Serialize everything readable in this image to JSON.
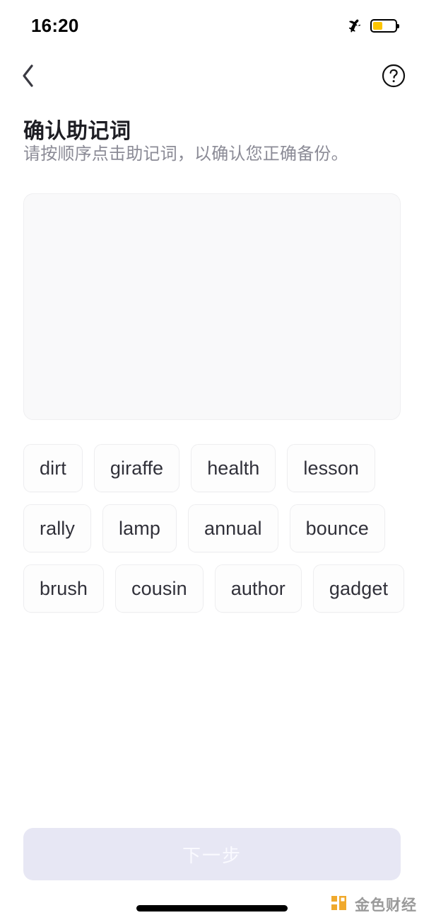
{
  "status_bar": {
    "time": "16:20",
    "airplane_icon": "airplane-mode-icon",
    "battery_icon": "battery-low-power-icon",
    "battery_color": "#fdc500",
    "battery_level_percent": 42
  },
  "nav_bar": {
    "back_icon": "chevron-left-icon",
    "help_icon": "question-mark-circle-icon"
  },
  "header": {
    "title": "确认助记词",
    "subtitle": "请按顺序点击助记词，以确认您正确备份。"
  },
  "answer_box": {
    "selected_words": [],
    "background_color": "#f9f9fa",
    "border_color": "#efeff1"
  },
  "word_pool": {
    "words": [
      "dirt",
      "giraffe",
      "health",
      "lesson",
      "rally",
      "lamp",
      "annual",
      "bounce",
      "brush",
      "cousin",
      "author",
      "gadget"
    ]
  },
  "footer": {
    "next_label": "下一步",
    "next_disabled": true,
    "next_background_color": "#e7e7f4",
    "next_text_color": "#fafaff"
  },
  "watermark": {
    "text": "金色财经",
    "logo_icon": "jinse-finance-logo-icon",
    "logo_color": "#f0a92c"
  },
  "home_indicator": {
    "icon": "home-indicator-bar"
  }
}
